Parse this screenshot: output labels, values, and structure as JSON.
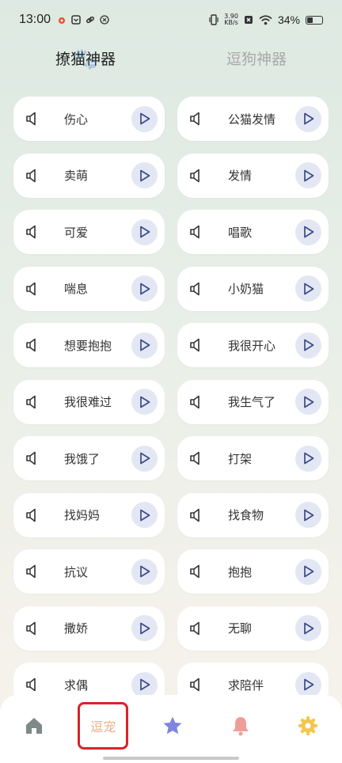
{
  "status_bar": {
    "time": "13:00",
    "net_speed_value": "3.90",
    "net_speed_unit": "KB/s",
    "battery": "34%"
  },
  "top_tabs": [
    {
      "label": "撩猫神器",
      "active": true
    },
    {
      "label": "逗狗神器",
      "active": false
    }
  ],
  "sounds": [
    "伤心",
    "公猫发情",
    "卖萌",
    "发情",
    "可爱",
    "唱歌",
    "喘息",
    "小奶猫",
    "想要抱抱",
    "我很开心",
    "我很难过",
    "我生气了",
    "我饿了",
    "打架",
    "找妈妈",
    "找食物",
    "抗议",
    "抱抱",
    "撒娇",
    "无聊",
    "求偶",
    "求陪伴"
  ],
  "bottom_nav": {
    "items": [
      "home-icon",
      "逗宠",
      "star-icon",
      "bell-icon",
      "settings-icon"
    ],
    "active_label": "逗宠"
  },
  "colors": {
    "play_bg": "#e3e7f4",
    "play_icon": "#3a4a8c",
    "star": "#7f86e0",
    "bell": "#ef9d98",
    "gear": "#f3c64f",
    "home": "#7f8a88",
    "highlight": "#d9232a"
  }
}
